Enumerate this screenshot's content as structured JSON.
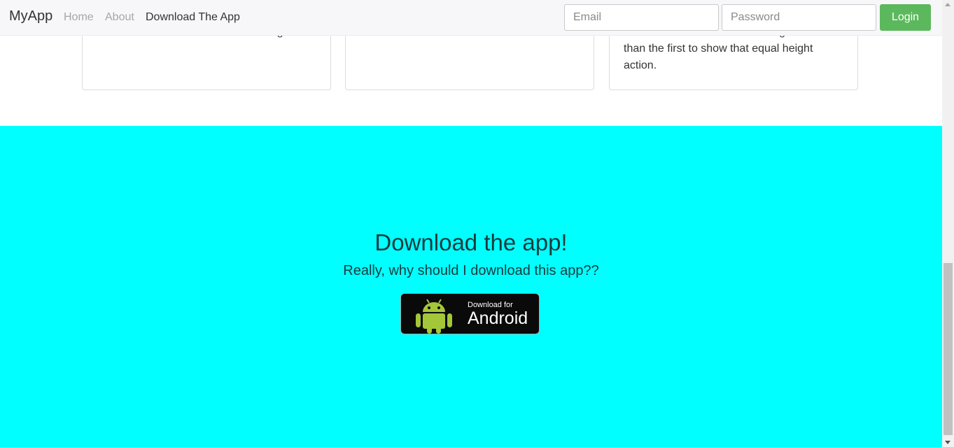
{
  "navbar": {
    "brand": "MyApp",
    "links": [
      "Home",
      "About",
      "Download The App"
    ],
    "email_placeholder": "Email",
    "password_placeholder": "Password",
    "login_label": "Login"
  },
  "cards": [
    {
      "text": "content. This content is a little bit longer."
    },
    {
      "text": ""
    },
    {
      "text": "content. This card has even longer content than the first to show that equal height action."
    }
  ],
  "download": {
    "title": "Download the app!",
    "subtitle": "Really, why should I download this app??",
    "badge_small": "Download for",
    "badge_big": "Android"
  },
  "colors": {
    "section_bg": "#00ffff",
    "login_bg": "#5cb85c",
    "android_green": "#a4c639"
  }
}
